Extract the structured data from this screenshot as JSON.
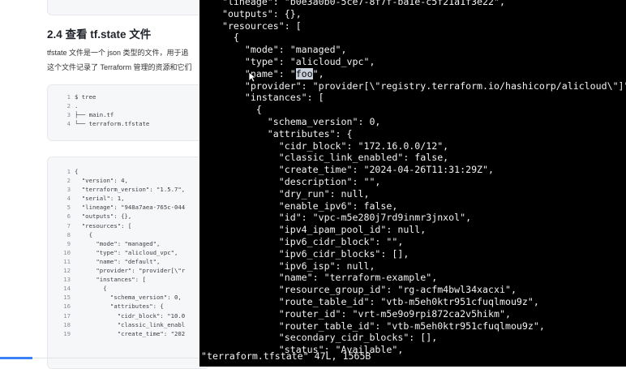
{
  "doc": {
    "heading": "2.4 查看 tf.state 文件",
    "para1": "tfstate 文件是一个 json 类型的文件，用于追",
    "para2": "这个文件记录了 Terraform 管理的资源和它们",
    "tree_code": [
      {
        "n": "1",
        "t": "$ tree"
      },
      {
        "n": "2",
        "t": "."
      },
      {
        "n": "3",
        "t": "├── main.tf"
      },
      {
        "n": "4",
        "t": "└── terraform.tfstate"
      }
    ],
    "json_code": [
      {
        "n": "1",
        "t": "{"
      },
      {
        "n": "2",
        "t": "  \"version\": 4,"
      },
      {
        "n": "3",
        "t": "  \"terraform_version\": \"1.5.7\","
      },
      {
        "n": "4",
        "t": "  \"serial\": 1,"
      },
      {
        "n": "5",
        "t": "  \"lineage\": \"948a7aea-765c-044"
      },
      {
        "n": "6",
        "t": "  \"outputs\": {},"
      },
      {
        "n": "7",
        "t": "  \"resources\": ["
      },
      {
        "n": "8",
        "t": "    {"
      },
      {
        "n": "9",
        "t": "      \"mode\": \"managed\","
      },
      {
        "n": "10",
        "t": "      \"type\": \"alicloud_vpc\","
      },
      {
        "n": "11",
        "t": "      \"name\": \"default\","
      },
      {
        "n": "12",
        "t": "      \"provider\": \"provider[\\\"r"
      },
      {
        "n": "13",
        "t": "      \"instances\": ["
      },
      {
        "n": "14",
        "t": "        {"
      },
      {
        "n": "15",
        "t": "          \"schema_version\": 0,"
      },
      {
        "n": "16",
        "t": "          \"attributes\": {"
      },
      {
        "n": "17",
        "t": "            \"cidr_block\": \"10.0"
      },
      {
        "n": "18",
        "t": "            \"classic_link_enabl"
      },
      {
        "n": "19",
        "t": "            \"create_time\": \"202"
      }
    ]
  },
  "terminal": {
    "lines": [
      "  \"lineage\": \"b0e3a0b0-5ce7-8f7f-ba1e-c5f21a1f3e22\",",
      "  \"outputs\": {},",
      "  \"resources\": [",
      "    {",
      "      \"mode\": \"managed\",",
      "      \"type\": \"alicloud_vpc\",",
      "      \"name\": \"",
      "      \"provider\": \"provider[\\\"registry.terraform.io/hashicorp/alicloud\\\"]\",",
      "      \"instances\": [",
      "        {",
      "          \"schema_version\": 0,",
      "          \"attributes\": {",
      "            \"cidr_block\": \"172.16.0.0/12\",",
      "            \"classic_link_enabled\": false,",
      "            \"create_time\": \"2024-04-26T11:31:29Z\",",
      "            \"description\": \"\",",
      "            \"dry_run\": null,",
      "            \"enable_ipv6\": false,",
      "            \"id\": \"vpc-m5e280j7rd9inmr3jnxol\",",
      "            \"ipv4_ipam_pool_id\": null,",
      "            \"ipv6_cidr_block\": \"\",",
      "            \"ipv6_cidr_blocks\": [],",
      "            \"ipv6_isp\": null,",
      "            \"name\": \"terraform-example\",",
      "            \"resource_group_id\": \"rg-acfm4bwl34xacxi\",",
      "            \"route_table_id\": \"vtb-m5eh0ktr951cfuqlmou9z\",",
      "            \"router_id\": \"vrt-m5e9o9rpi872ca2v5hikm\",",
      "            \"router_table_id\": \"vtb-m5eh0ktr951cfuqlmou9z\",",
      "            \"secondary_cidr_blocks\": [],",
      "            \"status\": \"Available\","
    ],
    "name_highlight": "foo",
    "name_suffix": "\",",
    "status_line": "\"terraform.tfstate\" 47L, 1565B"
  },
  "colors": {
    "terminal_bg": "#000000",
    "terminal_fg": "#f2f2f2",
    "selection_bg": "#c7d0dc",
    "scroll_accent": "#3b82f6"
  },
  "icons": [
    "mouse-cursor-icon"
  ]
}
